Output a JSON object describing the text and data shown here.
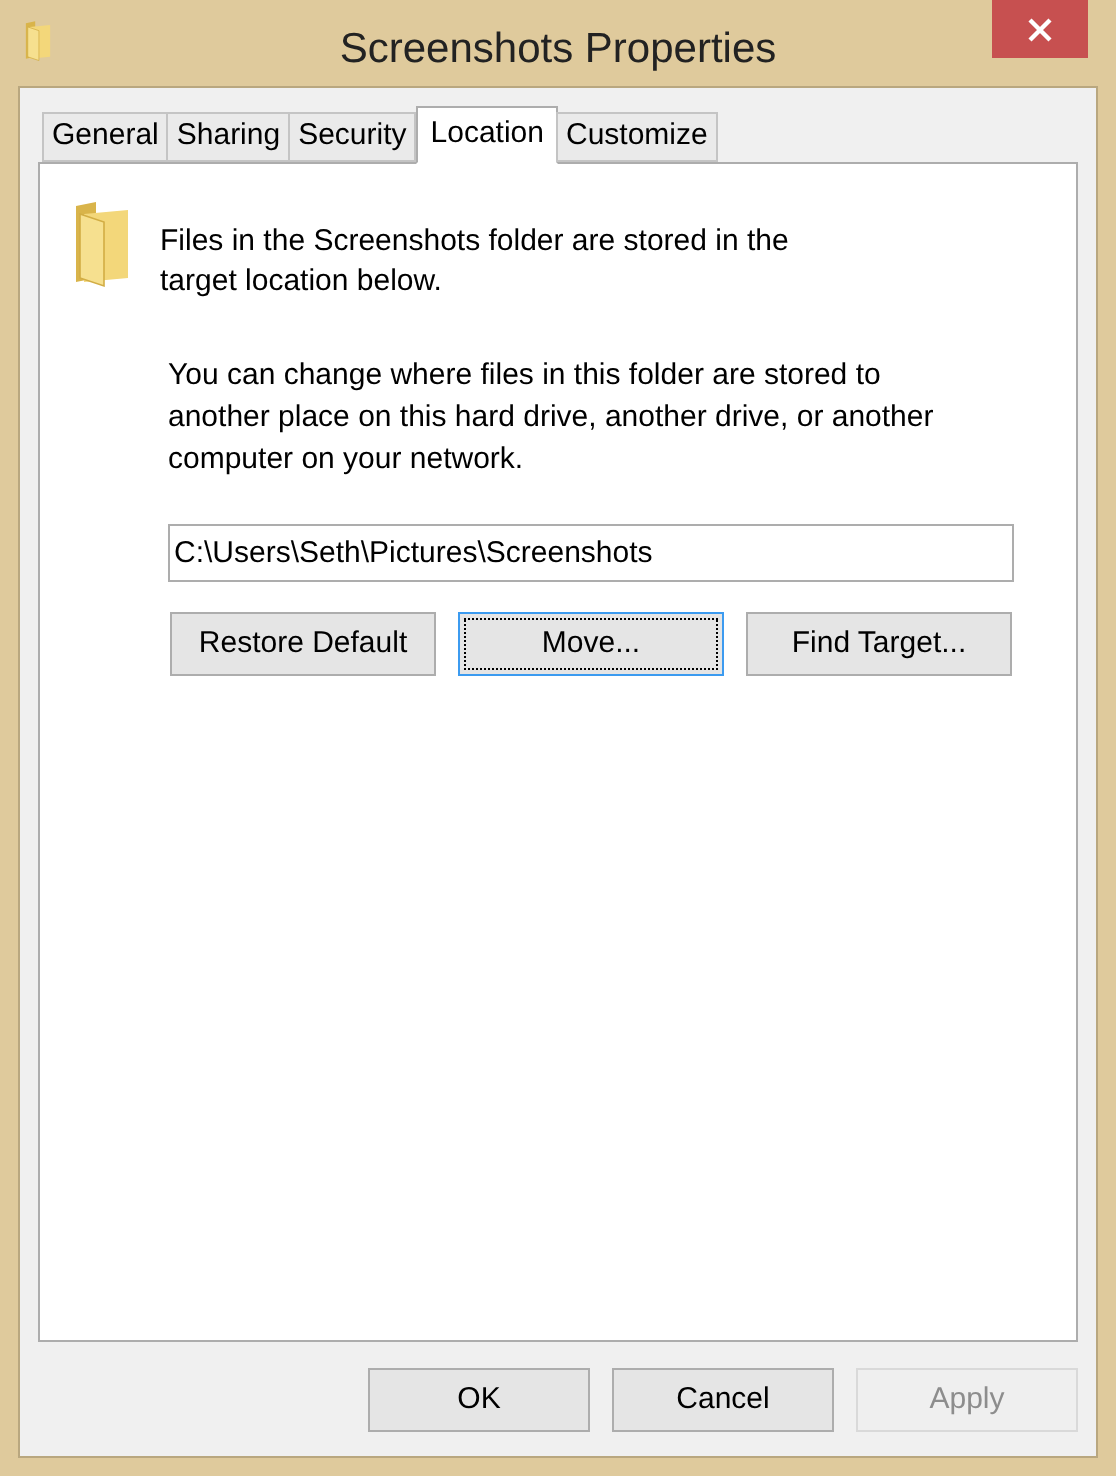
{
  "window": {
    "title": "Screenshots Properties"
  },
  "tabs": [
    {
      "label": "General",
      "selected": false
    },
    {
      "label": "Sharing",
      "selected": false
    },
    {
      "label": "Security",
      "selected": false
    },
    {
      "label": "Location",
      "selected": true
    },
    {
      "label": "Customize",
      "selected": false
    }
  ],
  "location": {
    "intro": "Files in the Screenshots folder are stored in the target location below.",
    "description": "You can change where files in this folder are stored to another place on this hard drive, another drive, or another computer on your network.",
    "path": "C:\\Users\\Seth\\Pictures\\Screenshots",
    "buttons": [
      {
        "label": "Restore Default",
        "focused": false
      },
      {
        "label": "Move...",
        "focused": true
      },
      {
        "label": "Find Target...",
        "focused": false
      }
    ]
  },
  "dialog_buttons": [
    {
      "label": "OK",
      "disabled": false
    },
    {
      "label": "Cancel",
      "disabled": false
    },
    {
      "label": "Apply",
      "disabled": true
    }
  ]
}
